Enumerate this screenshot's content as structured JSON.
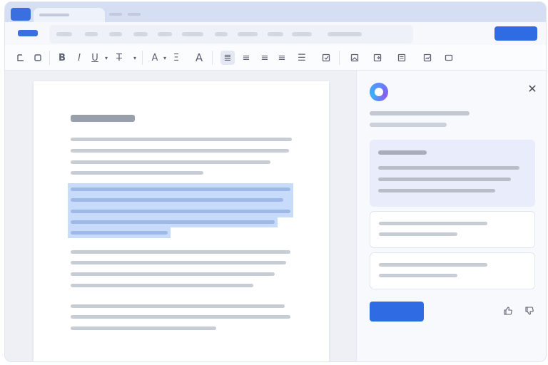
{
  "app": {
    "brand_color": "#3a6fe0",
    "accent_color": "#2f6ce3",
    "selection_color": "#c9dbfa"
  },
  "toolbar": {
    "icons": [
      "undo-icon",
      "redo-icon",
      "bold-icon",
      "italic-icon",
      "underline-icon",
      "dropdown-icon",
      "strikethrough-icon",
      "dropdown-icon",
      "font-size-icon",
      "highlight-icon",
      "text-color-icon",
      "align-left-icon",
      "align-center-icon",
      "align-right-icon",
      "align-justify-icon",
      "line-spacing-icon",
      "checklist-icon",
      "image-icon",
      "link-icon",
      "comment-icon",
      "chart-icon",
      "more-icon"
    ]
  },
  "document": {
    "paragraph_count": 4,
    "selected_paragraph": 2
  },
  "assistant": {
    "logo_icon": "assistant-logo-icon",
    "close_icon": "close-icon",
    "feedback_icons": [
      "thumbs-up-icon",
      "thumbs-down-icon"
    ]
  }
}
